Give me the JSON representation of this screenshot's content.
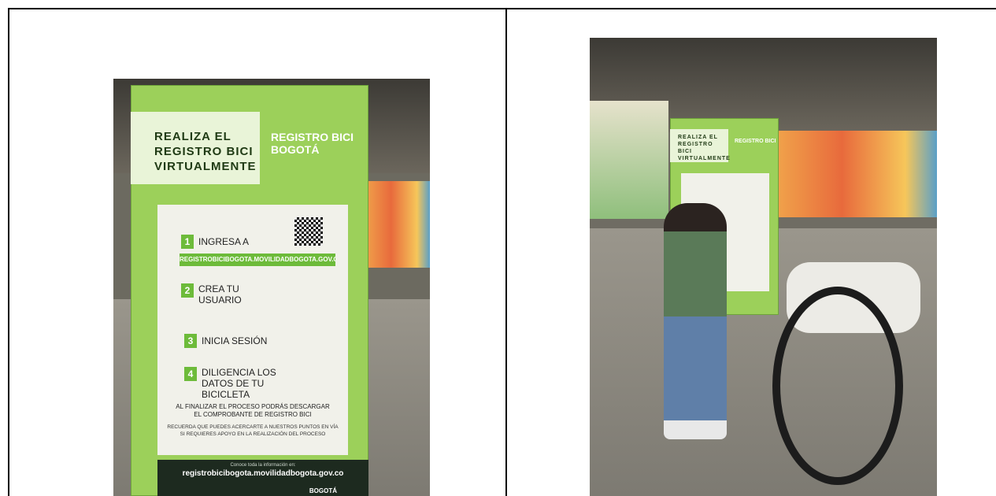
{
  "left_photo": {
    "banner": {
      "headline": "REALIZA EL REGISTRO BICI VIRTUALMENTE",
      "logo_text": "REGISTRO BICI BOGOTÁ",
      "steps": [
        {
          "number": "1",
          "label": "INGRESA A"
        },
        {
          "number": "2",
          "label": "CREA TU USUARIO"
        },
        {
          "number": "3",
          "label": "INICIA SESIÓN"
        },
        {
          "number": "4",
          "label": "DILIGENCIA LOS DATOS DE TU BICICLETA"
        }
      ],
      "url": "REGISTROBICIBOGOTA.MOVILIDADBOGOTA.GOV.CO",
      "closing_text": "AL FINALIZAR EL PROCESO PODRÁS DESCARGAR EL COMPROBANTE DE REGISTRO BICI",
      "reminder_text": "RECUERDA QUE PUEDES ACERCARTE A NUESTROS PUNTOS EN VÍA SI REQUIERES APOYO EN LA REALIZACIÓN DEL PROCESO",
      "footer_caption": "Conoce toda la información en:",
      "footer_url": "registrobicibogota.movilidadbogota.gov.co",
      "footer_brand": "BOGOTÁ"
    }
  },
  "right_photo": {
    "banner": {
      "headline": "REALIZA EL REGISTRO BICI VIRTUALMENTE",
      "logo_text": "REGISTRO BICI"
    }
  },
  "colors": {
    "banner_green": "#9cd05a",
    "step_green": "#6dbb3a",
    "footer_dark": "#1d2a1f"
  }
}
